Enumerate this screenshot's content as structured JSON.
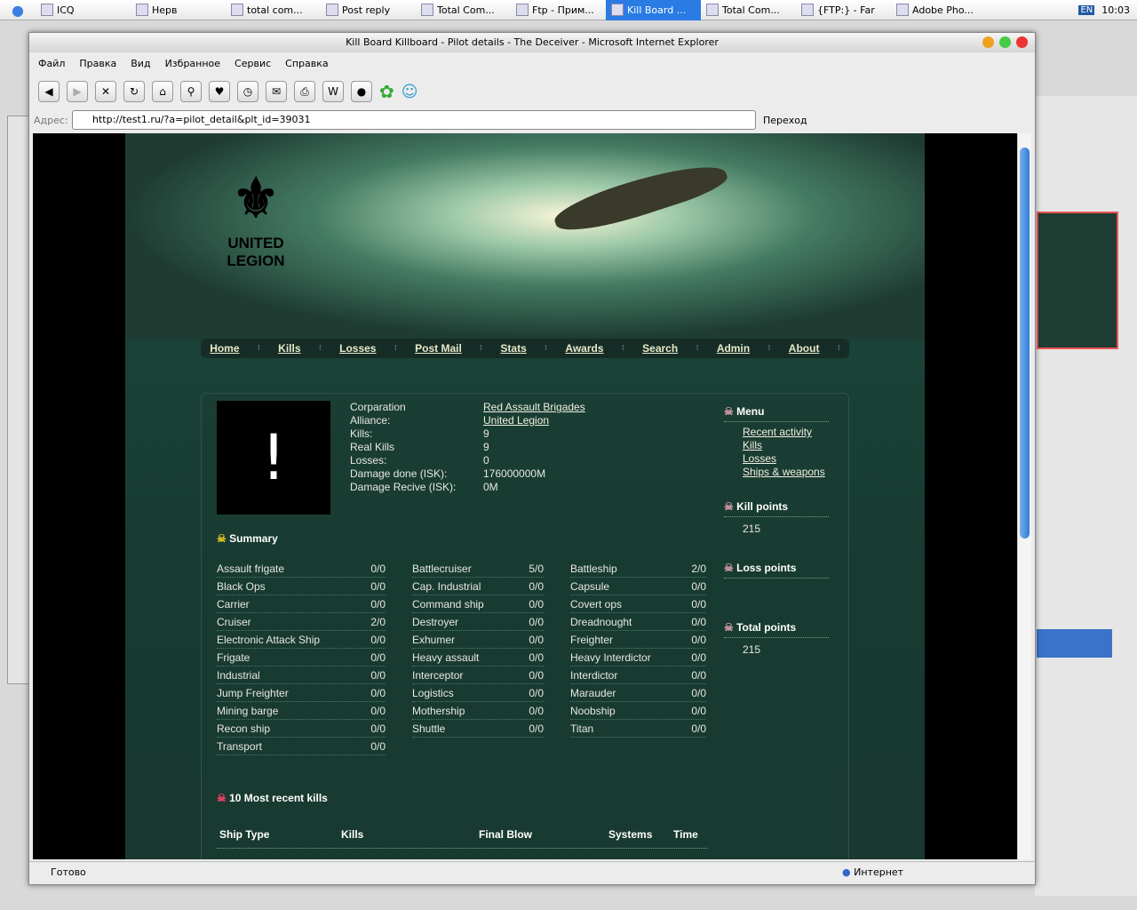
{
  "taskbar": {
    "items": [
      "ICQ",
      "Нерв",
      "total com...",
      "Post reply",
      "Total Com...",
      "Ftp - Прим...",
      "Kill Board ...",
      "Total Com...",
      "{FTP:} - Far",
      "Adobe Pho..."
    ],
    "active": 6,
    "lang": "EN",
    "clock": "10:03"
  },
  "window": {
    "title": "Kill Board Killboard - Pilot details - The Deceiver - Microsoft Internet Explorer"
  },
  "menu": [
    "Файл",
    "Правка",
    "Вид",
    "Избранное",
    "Сервис",
    "Справка"
  ],
  "address": {
    "label": "Адрес:",
    "url": "http://test1.ru/?a=pilot_detail&plt_id=39031",
    "go": "Переход"
  },
  "status": {
    "left": "Готово",
    "zone": "Интернет"
  },
  "site": {
    "logo": "UNITED LEGION",
    "nav": [
      "Home",
      "Kills",
      "Losses",
      "Post Mail",
      "Stats",
      "Awards",
      "Search",
      "Admin",
      "About"
    ],
    "pilot": [
      {
        "label": "Corparation",
        "value": "Red Assault Brigades",
        "link": true
      },
      {
        "label": "Alliance:",
        "value": "United Legion",
        "link": true
      },
      {
        "label": "Kills:",
        "value": "9"
      },
      {
        "label": "Real Kills",
        "value": "9"
      },
      {
        "label": "Losses:",
        "value": "0"
      },
      {
        "label": "Damage done (ISK):",
        "value": "176000000M"
      },
      {
        "label": "Damage Recive (ISK):",
        "value": "0M"
      }
    ],
    "avatar_glyph": "!",
    "summary_title": "Summary",
    "summary": [
      [
        [
          "Assault frigate",
          "0/0"
        ],
        [
          "Black Ops",
          "0/0"
        ],
        [
          "Carrier",
          "0/0"
        ],
        [
          "Cruiser",
          "2/0"
        ],
        [
          "Electronic Attack Ship",
          "0/0"
        ],
        [
          "Frigate",
          "0/0"
        ],
        [
          "Industrial",
          "0/0"
        ],
        [
          "Jump Freighter",
          "0/0"
        ],
        [
          "Mining barge",
          "0/0"
        ],
        [
          "Recon ship",
          "0/0"
        ],
        [
          "Transport",
          "0/0"
        ]
      ],
      [
        [
          "Battlecruiser",
          "5/0"
        ],
        [
          "Cap. Industrial",
          "0/0"
        ],
        [
          "Command ship",
          "0/0"
        ],
        [
          "Destroyer",
          "0/0"
        ],
        [
          "Exhumer",
          "0/0"
        ],
        [
          "Heavy assault",
          "0/0"
        ],
        [
          "Interceptor",
          "0/0"
        ],
        [
          "Logistics",
          "0/0"
        ],
        [
          "Mothership",
          "0/0"
        ],
        [
          "Shuttle",
          "0/0"
        ]
      ],
      [
        [
          "Battleship",
          "2/0"
        ],
        [
          "Capsule",
          "0/0"
        ],
        [
          "Covert ops",
          "0/0"
        ],
        [
          "Dreadnought",
          "0/0"
        ],
        [
          "Freighter",
          "0/0"
        ],
        [
          "Heavy Interdictor",
          "0/0"
        ],
        [
          "Interdictor",
          "0/0"
        ],
        [
          "Marauder",
          "0/0"
        ],
        [
          "Noobship",
          "0/0"
        ],
        [
          "Titan",
          "0/0"
        ]
      ]
    ],
    "side": {
      "menu_title": "Menu",
      "menu": [
        "Recent activity",
        "Kills",
        "Losses",
        "Ships & weapons"
      ],
      "kill_points_title": "Kill points",
      "kill_points": "215",
      "loss_points_title": "Loss points",
      "total_points_title": "Total points",
      "total_points": "215"
    },
    "recent_title": "10 Most recent kills",
    "recent_headers": [
      "Ship Type",
      "Kills",
      "Final Blow",
      "Systems",
      "Time"
    ]
  }
}
